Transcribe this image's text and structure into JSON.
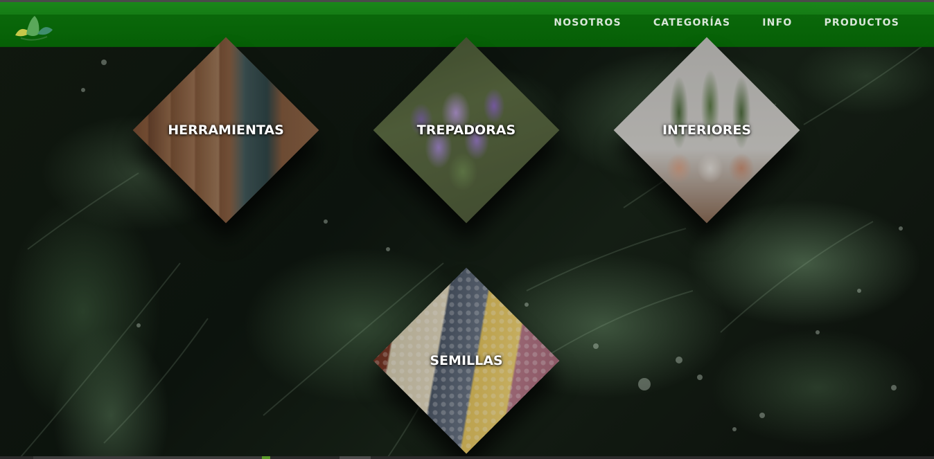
{
  "navbar": {
    "logo_icon": "leaf-lotus-logo-icon",
    "links": [
      {
        "label": "NOSOTROS"
      },
      {
        "label": "CATEGORÍAS"
      },
      {
        "label": "INFO"
      },
      {
        "label": "PRODUCTOS"
      }
    ],
    "background_color": "#0a6e0a",
    "link_color": "#d9e6d9"
  },
  "background": {
    "icon": "wet-leaves-background-image"
  },
  "categories": [
    {
      "label": "HERRAMIENTAS",
      "image_icon": "garden-tools-image"
    },
    {
      "label": "TREPADORAS",
      "image_icon": "wisteria-vines-image"
    },
    {
      "label": "INTERIORES",
      "image_icon": "potted-snake-plants-image"
    },
    {
      "label": "SEMILLAS",
      "image_icon": "assorted-seeds-image"
    }
  ]
}
